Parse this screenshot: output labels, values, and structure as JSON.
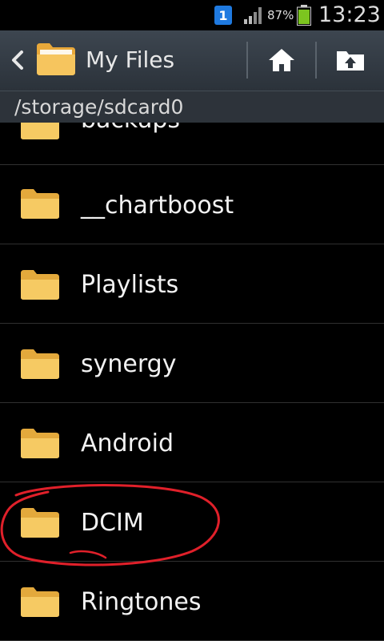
{
  "status_bar": {
    "notification_badge": "1",
    "battery_percent": "87%",
    "clock": "13:23",
    "colors": {
      "battery": "#7cc51f",
      "notification": "#1f7ae0"
    },
    "icons": [
      "notification-icon",
      "signal-icon",
      "battery-icon"
    ]
  },
  "action_bar": {
    "title": "My Files",
    "icons": [
      "back-chevron-icon",
      "folder-icon",
      "home-icon",
      "upload-icon"
    ]
  },
  "path_bar": {
    "path": "/storage/sdcard0"
  },
  "file_list": {
    "items": [
      {
        "name": "backups"
      },
      {
        "name": "__chartboost"
      },
      {
        "name": "Playlists"
      },
      {
        "name": "synergy"
      },
      {
        "name": "Android"
      },
      {
        "name": "DCIM"
      },
      {
        "name": "Ringtones"
      }
    ],
    "folder_color": "#f3c45a"
  },
  "annotation": {
    "highlighted_item": "DCIM",
    "color": "#e0202a"
  }
}
